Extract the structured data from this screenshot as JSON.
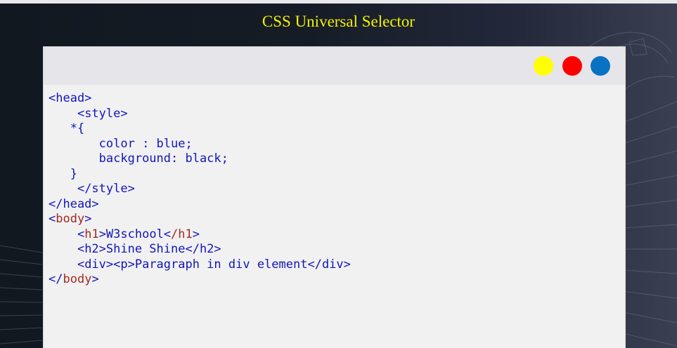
{
  "page": {
    "title": "CSS Universal Selector"
  },
  "window": {
    "controls": [
      {
        "name": "yellow-dot",
        "color": "#ffff00"
      },
      {
        "name": "red-dot",
        "color": "#ff0000"
      },
      {
        "name": "blue-dot",
        "color": "#0a72c2"
      }
    ]
  },
  "code": {
    "lines": [
      {
        "indent": "",
        "parts": [
          "<head>"
        ]
      },
      {
        "indent": "    ",
        "parts": [
          "<style>"
        ]
      },
      {
        "indent": "   ",
        "parts": [
          "*{"
        ]
      },
      {
        "indent": "       ",
        "parts": [
          "color : blue;"
        ]
      },
      {
        "indent": "       ",
        "parts": [
          "background: black;"
        ]
      },
      {
        "indent": "   ",
        "parts": [
          "}"
        ]
      },
      {
        "indent": "    ",
        "parts": [
          "</style>"
        ]
      },
      {
        "indent": "",
        "parts": [
          "</head>"
        ]
      },
      {
        "indent": "",
        "pre": "<",
        "tag": "body",
        "post": ">"
      },
      {
        "indent": "    ",
        "pre": "<",
        "tag": "h1",
        "mid": ">W3school<",
        "tag2": "/h1",
        "post": ">"
      },
      {
        "indent": "    ",
        "parts": [
          "<h2>Shine Shine</h2>"
        ]
      },
      {
        "indent": "    ",
        "parts": [
          "<div><p>Paragraph in div element</div>"
        ]
      },
      {
        "indent": "",
        "pre": "</",
        "tag": "body",
        "post": ">"
      }
    ]
  },
  "colors": {
    "title": "#f2f200",
    "code_text": "#1216b8",
    "code_tag": "#a52a1f",
    "window_bg": "#f1f1f2",
    "window_bar": "#e5e5ea"
  }
}
